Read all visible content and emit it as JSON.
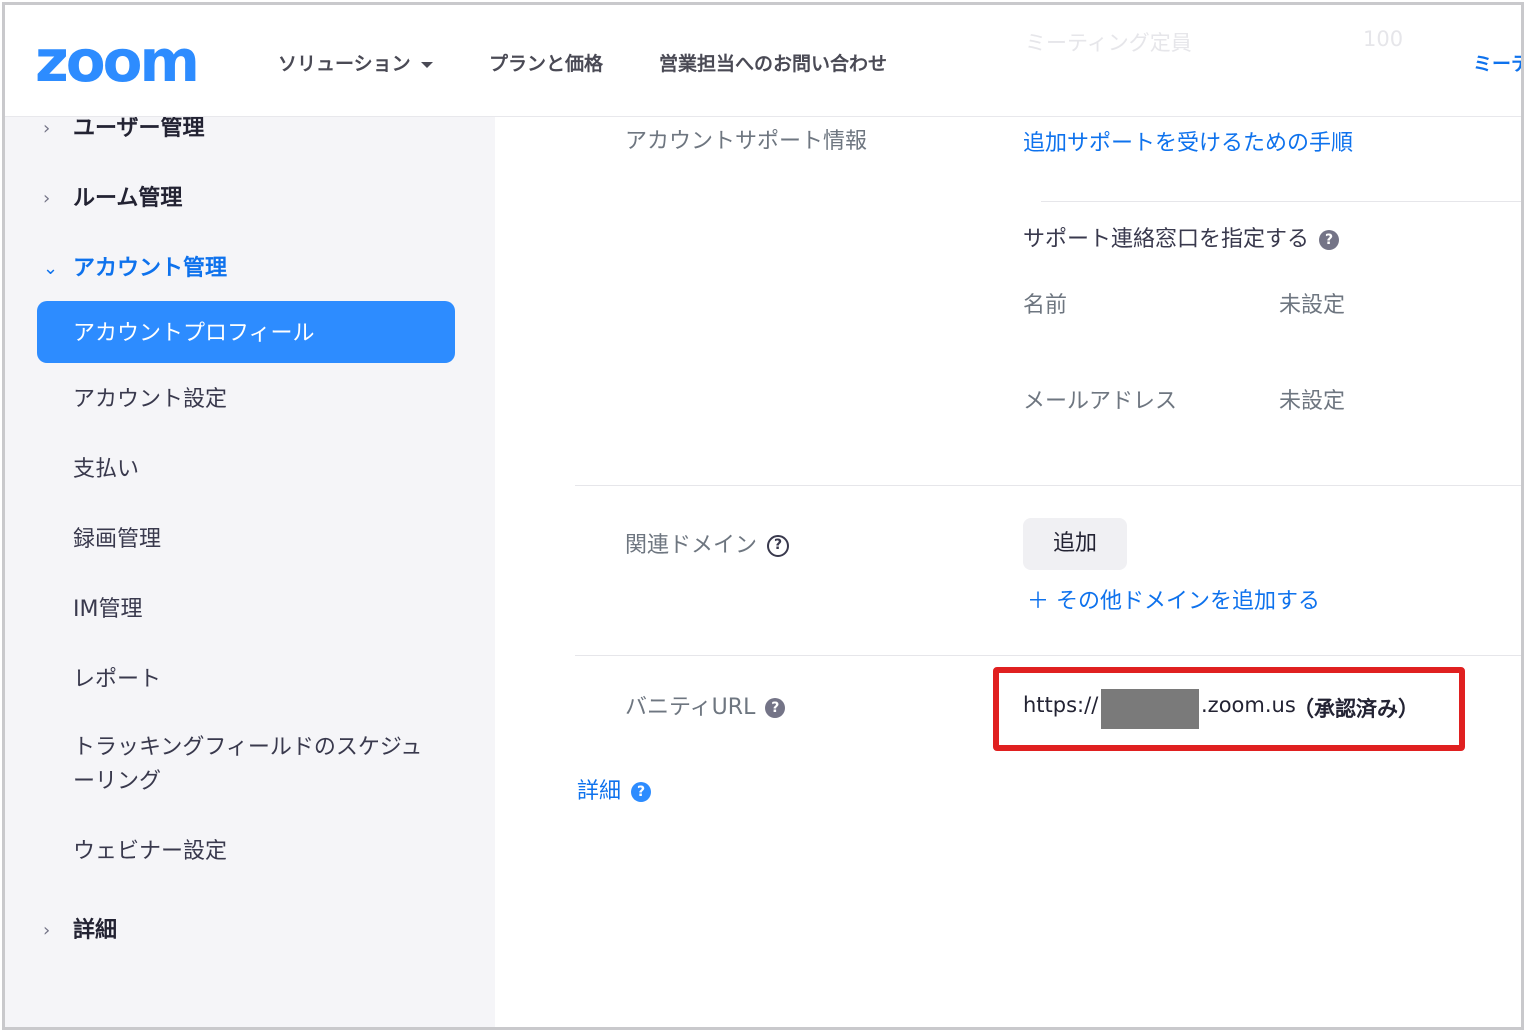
{
  "header": {
    "logo": "zoom",
    "nav": [
      "ソリューション",
      "プランと価格",
      "営業担当へのお問い合わせ"
    ],
    "faded_left": "ミーティング定員",
    "faded_right": "100",
    "meeting_link": "ミーテ"
  },
  "sidebar": {
    "user_mgmt": "ユーザー管理",
    "room_mgmt": "ルーム管理",
    "account_mgmt": "アカウント管理",
    "active": "アカウントプロフィール",
    "subs": [
      "アカウント設定",
      "支払い",
      "録画管理",
      "IM管理",
      "レポート",
      "トラッキングフィールドのスケジューリング",
      "ウェビナー設定"
    ],
    "details": "詳細"
  },
  "main": {
    "support_label": "アカウントサポート情報",
    "support_link": "追加サポートを受けるための手順",
    "contact_title": "サポート連絡窓口を指定する",
    "name_label": "名前",
    "name_value": "未設定",
    "email_label": "メールアドレス",
    "email_value": "未設定",
    "domain_label": "関連ドメイン",
    "add_button": "追加",
    "add_more": "その他ドメインを追加する",
    "vanity_label": "バニティURL",
    "vanity_prefix": "https://",
    "vanity_suffix": ".zoom.us",
    "vanity_status": "（承認済み）",
    "details_link": "詳細"
  }
}
